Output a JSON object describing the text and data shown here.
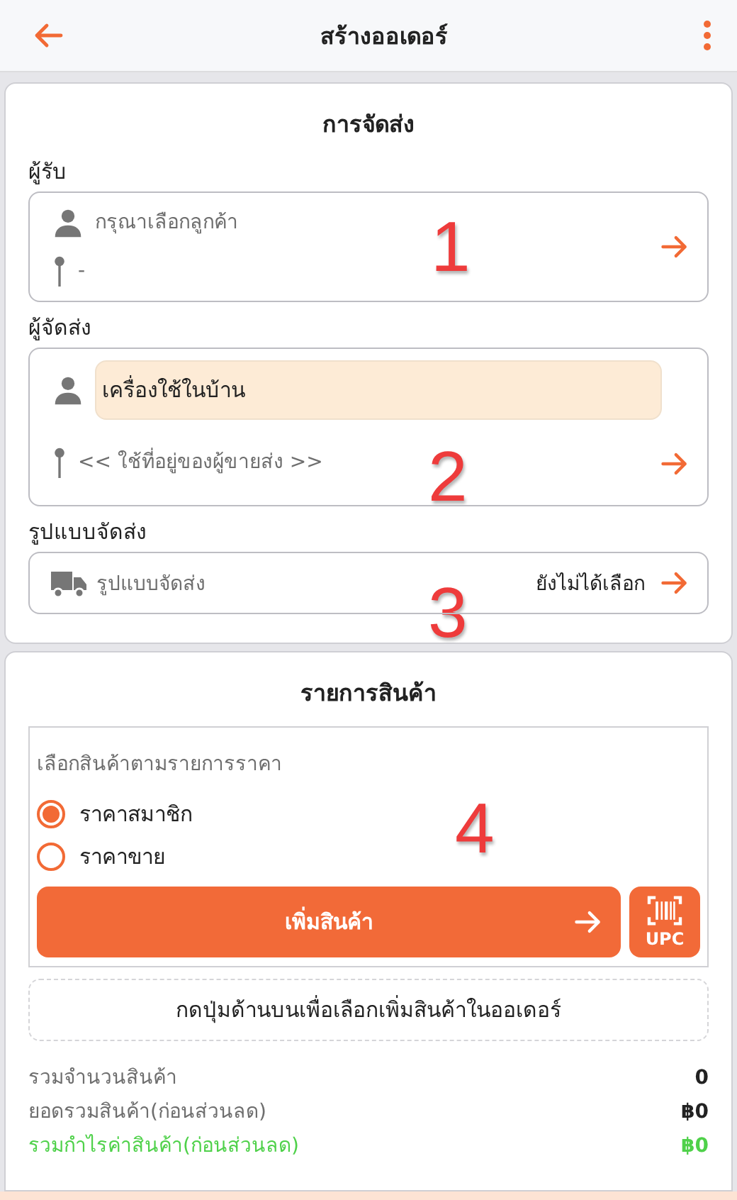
{
  "header": {
    "title": "สร้างออเดอร์"
  },
  "delivery": {
    "title": "การจัดส่ง",
    "marker": "1",
    "recipient": {
      "label": "ผู้รับ",
      "name_placeholder": "กรุณาเลือกลูกค้า",
      "address": "-"
    },
    "sender": {
      "label": "ผู้จัดส่ง",
      "name": "เครื่องใช้ในบ้าน",
      "address": "<< ใช้ที่อยู่ของผู้ขายส่ง >>",
      "marker": "2"
    },
    "shipping": {
      "label": "รูปแบบจัดส่ง",
      "field": "รูปแบบจัดส่ง",
      "value": "ยังไม่ได้เลือก",
      "marker": "3"
    }
  },
  "products": {
    "title": "รายการสินค้า",
    "marker": "4",
    "price_label": "เลือกสินค้าตามรายการราคา",
    "price_options": [
      {
        "label": "ราคาสมาชิก",
        "selected": true
      },
      {
        "label": "ราคาขาย",
        "selected": false
      }
    ],
    "add_button": "เพิ่มสินค้า",
    "upc_button": "UPC",
    "hint": "กดปุ่มด้านบนเพื่อเลือกเพิ่มสินค้าในออเดอร์",
    "totals": [
      {
        "label": "รวมจำนวนสินค้า",
        "value": "0",
        "kind": "normal"
      },
      {
        "label": "ยอดรวมสินค้า(ก่อนส่วนลด)",
        "value": "฿0",
        "kind": "normal"
      },
      {
        "label": "รวมกำไรค่าสินค้า(ก่อนส่วนลด)",
        "value": "฿0",
        "kind": "profit"
      }
    ]
  }
}
